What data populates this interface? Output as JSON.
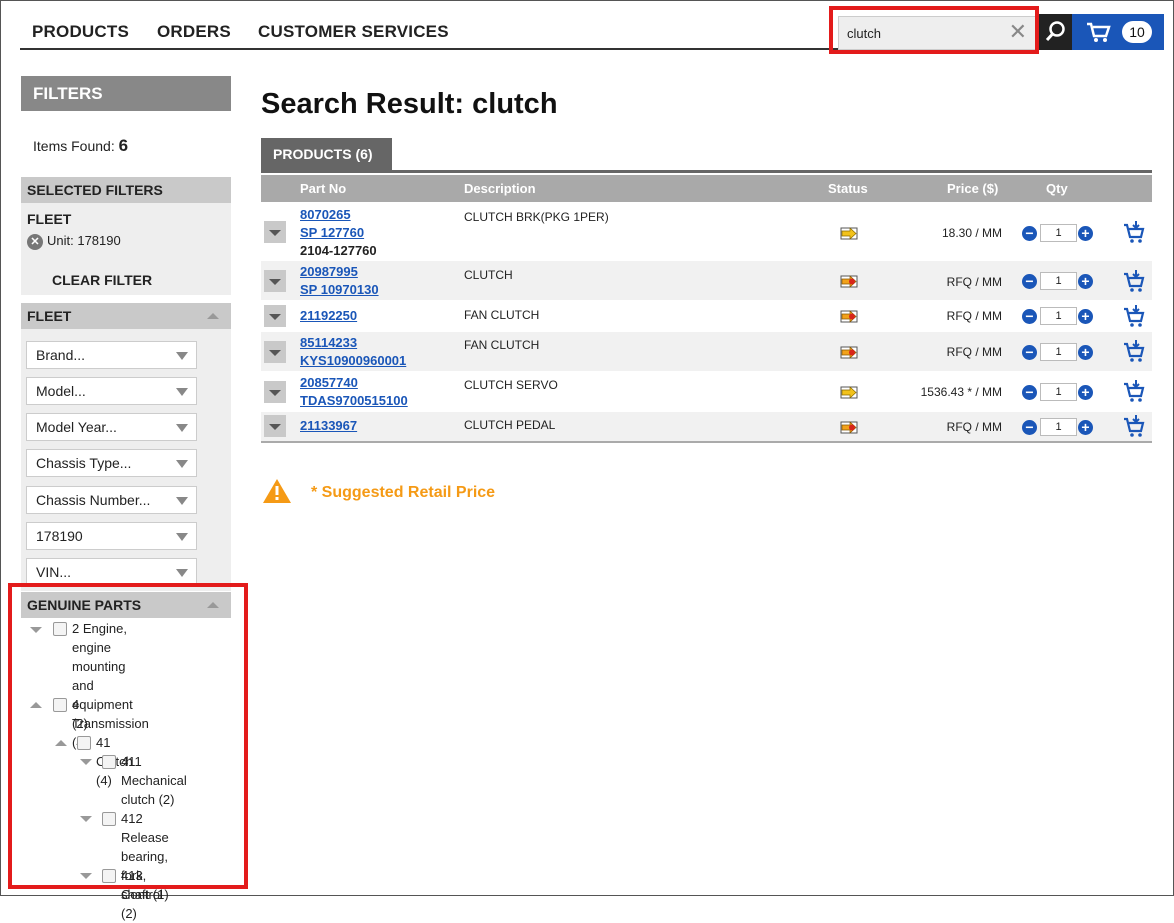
{
  "nav": {
    "items": [
      "PRODUCTS",
      "ORDERS",
      "CUSTOMER SERVICES"
    ],
    "search_value": "clutch",
    "clear_glyph": "✕",
    "cart_count": "10"
  },
  "sidebar": {
    "filters_title": "FILTERS",
    "items_found_label": "Items Found:",
    "items_found_count": "6",
    "selected_filters_title": "SELECTED FILTERS",
    "selected_fleet_label": "FLEET",
    "selected_unit": "Unit: 178190",
    "clear_filter": "CLEAR FILTER",
    "fleet_title": "FLEET",
    "fleet_selects": [
      "Brand...",
      "Model...",
      "Model Year...",
      "Chassis Type...",
      "Chassis Number...",
      "178190",
      "VIN..."
    ],
    "genuine_title": "GENUINE PARTS",
    "tree": [
      {
        "label": [
          "2 Engine,",
          "engine",
          "mounting and",
          "equipment (2)"
        ],
        "level": 0,
        "expanded": false
      },
      {
        "label": [
          "4 Transmission",
          "(4)"
        ],
        "level": 0,
        "expanded": true
      },
      {
        "label": [
          "41 Clutch (4)"
        ],
        "level": 1,
        "expanded": true
      },
      {
        "label": [
          "411",
          "Mechanical",
          "clutch (2)"
        ],
        "level": 2,
        "expanded": false
      },
      {
        "label": [
          "412 Release",
          "bearing, fork,",
          "shaft (1)"
        ],
        "level": 2,
        "expanded": false
      },
      {
        "label": [
          "413 Control (2)"
        ],
        "level": 2,
        "expanded": false
      }
    ]
  },
  "main": {
    "title": "Search Result: clutch",
    "tab_label": "PRODUCTS (6)",
    "columns": {
      "part_no": "Part No",
      "description": "Description",
      "status": "Status",
      "price": "Price ($)",
      "qty": "Qty"
    },
    "rows": [
      {
        "parts": [
          "8070265",
          "SP 127760"
        ],
        "extra": "2104-127760",
        "description": "CLUTCH BRK(PKG 1PER)",
        "status": "in-stock",
        "price": "18.30 / MM",
        "qty": "1"
      },
      {
        "parts": [
          "20987995",
          "SP 10970130"
        ],
        "extra": "",
        "description": "CLUTCH",
        "status": "rfq",
        "price": "RFQ / MM",
        "qty": "1"
      },
      {
        "parts": [
          "21192250"
        ],
        "extra": "",
        "description": "FAN CLUTCH",
        "status": "rfq",
        "price": "RFQ / MM",
        "qty": "1"
      },
      {
        "parts": [
          "85114233",
          "KYS10900960001"
        ],
        "extra": "",
        "description": "FAN CLUTCH",
        "status": "rfq",
        "price": "RFQ / MM",
        "qty": "1"
      },
      {
        "parts": [
          "20857740",
          "TDAS9700515100"
        ],
        "extra": "",
        "description": "CLUTCH SERVO",
        "status": "in-stock",
        "price": "1536.43 * / MM",
        "qty": "1"
      },
      {
        "parts": [
          "21133967"
        ],
        "extra": "",
        "description": "CLUTCH PEDAL",
        "status": "rfq",
        "price": "RFQ / MM",
        "qty": "1"
      }
    ],
    "suggested_retail": "* Suggested Retail Price"
  },
  "colors": {
    "link": "#1a56b8",
    "warning": "#f59a15",
    "highlight": "#e31b1b"
  }
}
